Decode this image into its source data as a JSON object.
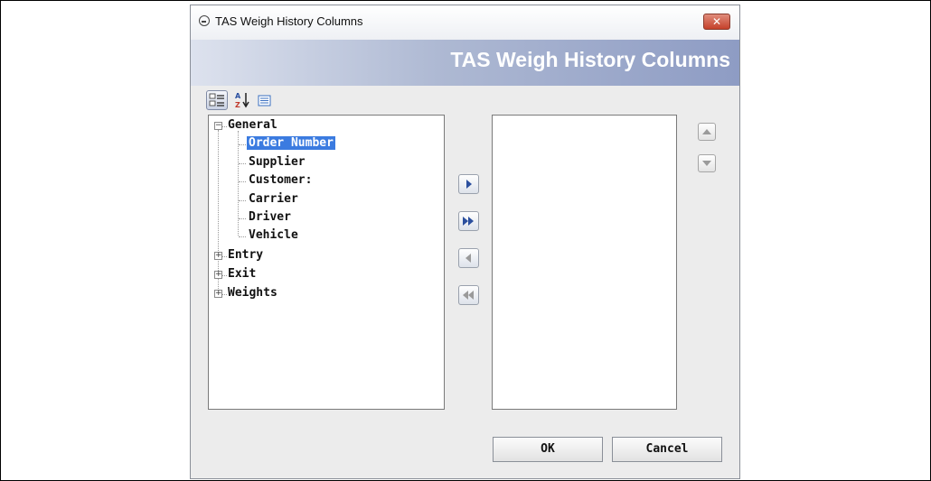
{
  "dialog": {
    "title": "TAS Weigh History Columns",
    "header_title": "TAS Weigh History Columns",
    "close_label": "✕"
  },
  "toolbar": {
    "categorized_icon": "categorized-view-icon",
    "alphabetical_icon": "sort-az-icon",
    "list_icon": "list-view-icon"
  },
  "tree": {
    "groups": [
      {
        "label": "General",
        "expanded": true,
        "children": [
          "Order Number",
          "Supplier",
          "Customer:",
          "Carrier",
          "Driver",
          "Vehicle"
        ],
        "selected": "Order Number"
      },
      {
        "label": "Entry",
        "expanded": false
      },
      {
        "label": "Exit",
        "expanded": false
      },
      {
        "label": "Weights",
        "expanded": false
      }
    ]
  },
  "transfer_buttons": [
    "add-selected",
    "add-all",
    "remove-selected",
    "remove-all"
  ],
  "order_buttons": [
    "move-up",
    "move-down"
  ],
  "buttons": {
    "ok": "OK",
    "cancel": "Cancel"
  },
  "colors": {
    "header_band": "#8e9cc4",
    "selection": "#3b7be0",
    "close_button": "#c5412a"
  }
}
